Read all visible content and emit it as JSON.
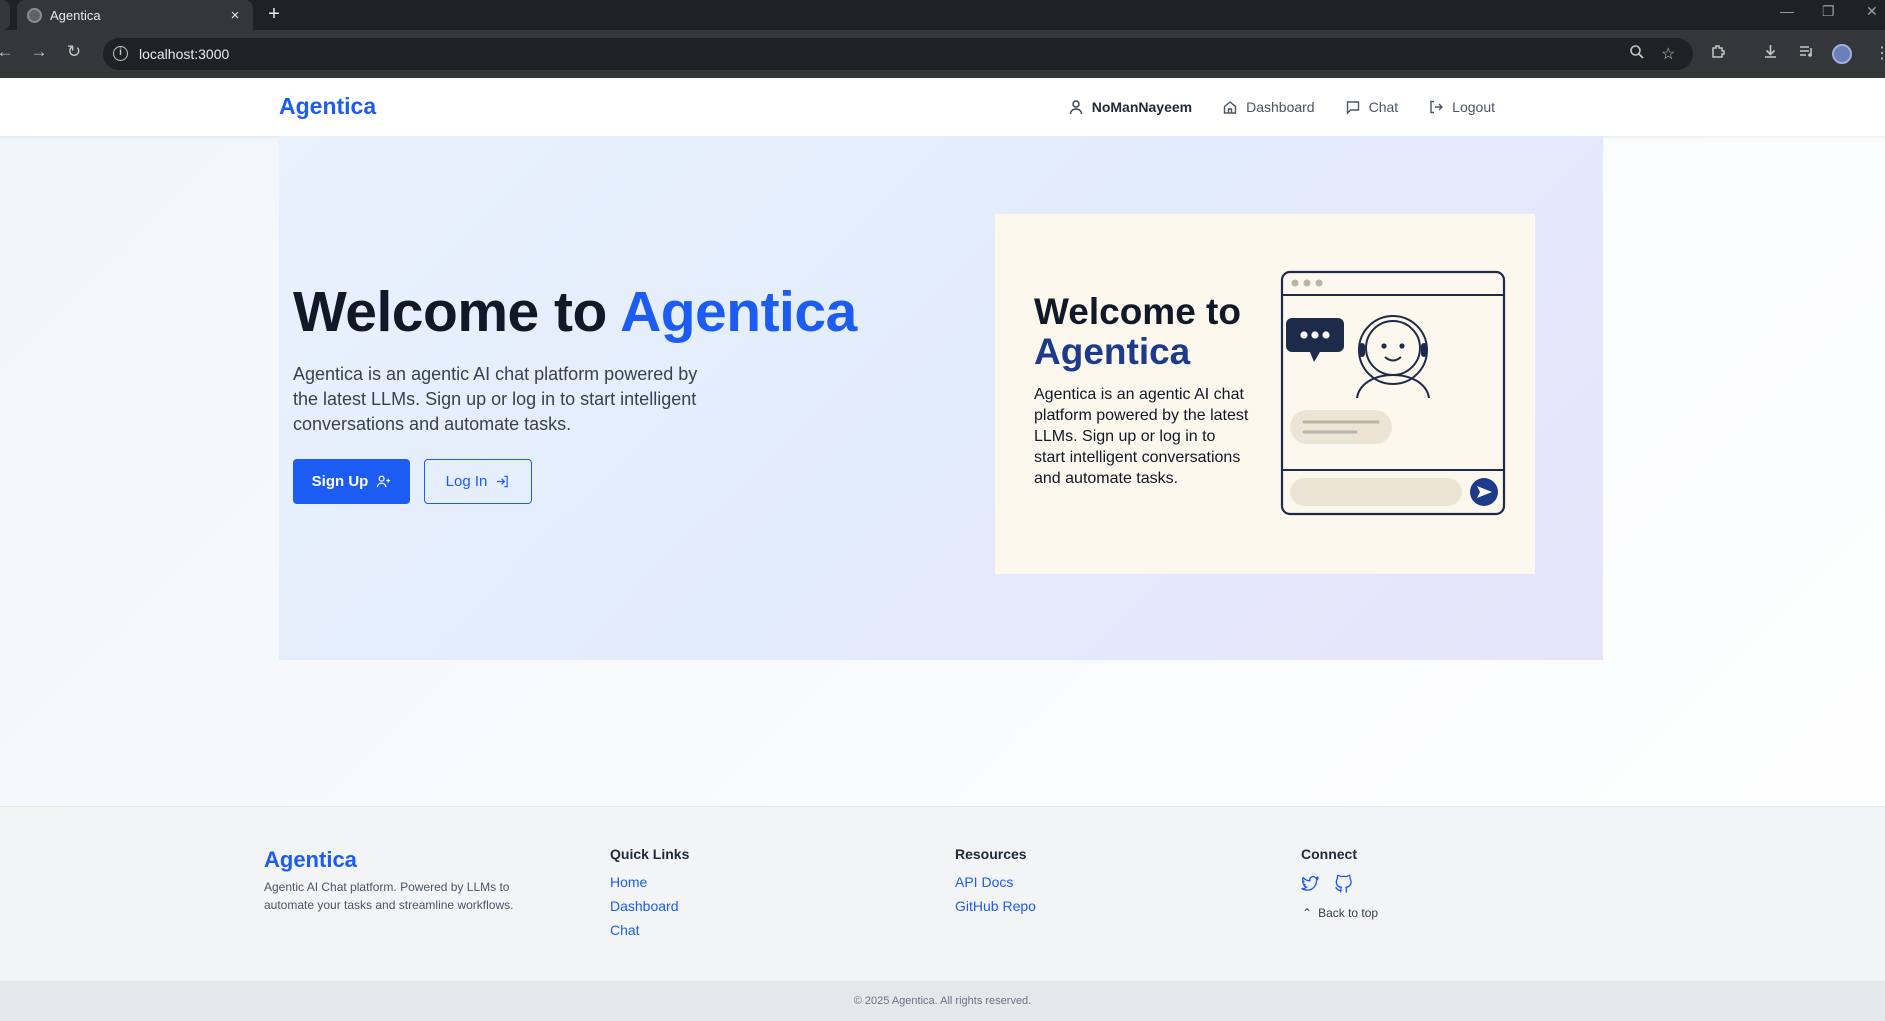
{
  "browser": {
    "tab_title": "Agentica",
    "tab_close": "×",
    "new_tab": "+",
    "url": "localhost:3000"
  },
  "navbar": {
    "brand": "Agentica",
    "user": "NoManNayeem",
    "dashboard": "Dashboard",
    "chat": "Chat",
    "logout": "Logout"
  },
  "hero": {
    "title_prefix": "Welcome to ",
    "title_accent": "Agentica",
    "description": "Agentica is an agentic AI chat platform powered by the latest LLMs. Sign up or log in to start intelligent conversations and automate tasks.",
    "signup_label": "Sign Up",
    "login_label": "Log In"
  },
  "illustration": {
    "title_prefix": "Welcome to",
    "title_accent": "Agentica",
    "description": "Agentica is an agentic AI chat platform powered by the latest LLMs. Sign up or log in to start intelligent conversations and automate tasks."
  },
  "footer": {
    "brand": "Agentica",
    "tagline": "Agentic AI Chat platform. Powered by LLMs to automate your tasks and streamline workflows.",
    "quick_links": {
      "heading": "Quick Links",
      "items": [
        "Home",
        "Dashboard",
        "Chat"
      ]
    },
    "resources": {
      "heading": "Resources",
      "items": [
        "API Docs",
        "GitHub Repo"
      ]
    },
    "connect": {
      "heading": "Connect",
      "icons": [
        "twitter-icon",
        "github-icon"
      ]
    },
    "back_to_top": "Back to top",
    "copyright": "© 2025 Agentica. All rights reserved."
  },
  "colors": {
    "brand": "#1d5cf2",
    "hero_bg": "#e3ecfc",
    "illustration_bg": "#fdf8ee",
    "footer_bg": "#f3f4f6"
  }
}
